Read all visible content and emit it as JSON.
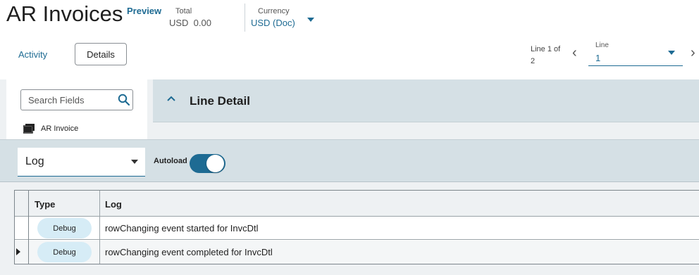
{
  "header": {
    "title": "AR Invoices",
    "preview": "Preview",
    "total_label": "Total",
    "total_value": "USD  0.00",
    "currency_label": "Currency",
    "currency_value": "USD (Doc)"
  },
  "tabs": {
    "activity": "Activity",
    "details": "Details"
  },
  "line_nav": {
    "line_of": "Line 1 of 2",
    "select_label": "Line",
    "select_value": "1"
  },
  "left_panel": {
    "search_placeholder": "Search Fields",
    "item_label": "AR Invoice"
  },
  "line_detail": {
    "title": "Line Detail"
  },
  "log_bar": {
    "select_value": "Log",
    "autoload_label": "Autoload",
    "autoload_on": true
  },
  "grid": {
    "columns": [
      "Type",
      "Log"
    ],
    "rows": [
      {
        "type": "Debug",
        "log": "rowChanging event started for InvcDtl"
      },
      {
        "type": "Debug",
        "log": "rowChanging event completed for InvcDtl"
      }
    ]
  },
  "colors": {
    "accent": "#1e6b93",
    "panel": "#d5e0e5",
    "badge": "#d6ecf6"
  }
}
